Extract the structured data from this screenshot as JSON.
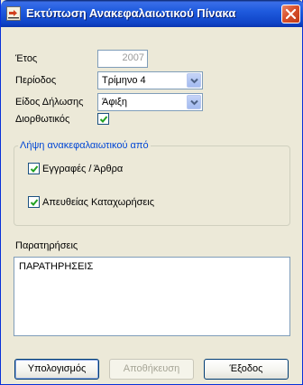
{
  "window": {
    "title": "Εκτύπωση Ανακεφαλαιωτικού Πίνακα",
    "icon": "print-report-icon",
    "close_icon": "close-icon"
  },
  "form": {
    "year_label": "Έτος",
    "year_value": "2007",
    "period_label": "Περίοδος",
    "period_value": "Τρίμηνο 4",
    "declaration_type_label": "Είδος Δήλωσης",
    "declaration_type_value": "Άφιξη",
    "corrective_label": "Διορθωτικός",
    "corrective_checked": true
  },
  "summary_group": {
    "legend": "Λήψη ανακεφαλαιωτικού από",
    "entries_label": "Εγγραφές / Άρθρα",
    "entries_checked": true,
    "direct_label": "Απευθείας Καταχωρήσεις",
    "direct_checked": true
  },
  "notes": {
    "label": "Παρατηρήσεις",
    "value": "ΠΑΡΑΤΗΡΗΣΕΙΣ"
  },
  "buttons": {
    "calculate": "Υπολογισμός",
    "save": "Αποθήκευση",
    "exit": "Έξοδος"
  },
  "colors": {
    "titlebar": "#0f44c7",
    "group_legend": "#0046d5",
    "checkmark": "#21a121"
  }
}
